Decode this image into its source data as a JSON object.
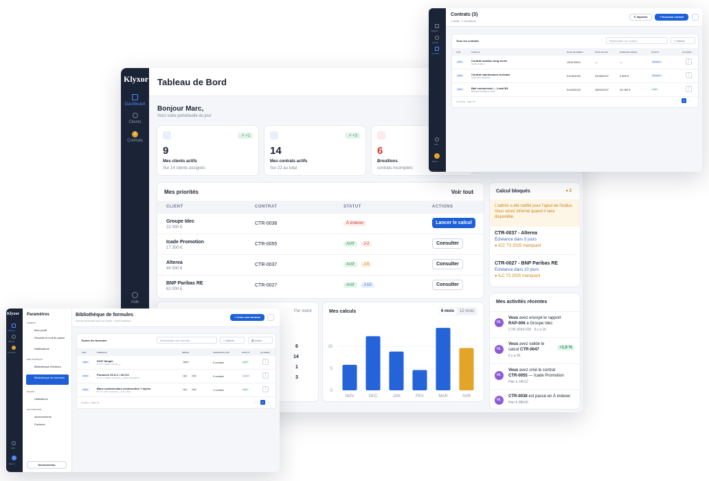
{
  "dashboard": {
    "logo": "Klyxor",
    "title": "Tableau de Bord",
    "nav": [
      {
        "label": "Dashboard"
      },
      {
        "label": "Clients"
      },
      {
        "label": "Contrats",
        "badge": "2"
      },
      {
        "label": "Aide"
      }
    ],
    "greeting": "Bonjour Marc,",
    "subtitle": "Voici votre portefeuille du jour",
    "stats": [
      {
        "value": "9",
        "label": "Mes clients actifs",
        "sub": "Sur 14 clients assignés",
        "delta": "+1",
        "icon": "users-icon"
      },
      {
        "value": "14",
        "label": "Mes contrats actifs",
        "sub": "Sur 22 au total",
        "delta": "+3",
        "icon": "document-icon"
      },
      {
        "value": "6",
        "label": "Brouillons",
        "sub": "contrats incomplets",
        "icon": "pencil-icon"
      }
    ],
    "priorities": {
      "title": "Mes priorités",
      "link": "Voir tout",
      "headers": [
        "CLIENT",
        "CONTRAT",
        "STATUT",
        "ACTIONS"
      ],
      "rows": [
        {
          "client": "Groupe Idec",
          "amount": "22 000 €",
          "contract": "CTR-0038",
          "status": "À indexer",
          "action": "Lancer le calcul"
        },
        {
          "client": "Icade Promotion",
          "amount": "17 300 €",
          "contract": "CTR-0055",
          "status": "Actif",
          "days": "J-2",
          "action": "Consulter"
        },
        {
          "client": "Alterea",
          "amount": "44 500 €",
          "contract": "CTR-0037",
          "status": "Actif",
          "days": "J-5",
          "action": "Consulter"
        },
        {
          "client": "BNP Paribas RE",
          "amount": "62 000 €",
          "contract": "CTR-0027",
          "status": "Actif",
          "days": "J-10",
          "action": "Consulter"
        }
      ]
    },
    "blocked": {
      "title": "Calcul bloqués",
      "count": "2",
      "notice": "L'admin a été notifié pour l'ajout de l'indice. Vous serez informé quand il sera disponible.",
      "items": [
        {
          "title": "CTR-0037 - Alterea",
          "due": "Échéance dans 5 jours",
          "missing": "ICC T3 2025 manquant"
        },
        {
          "title": "CTR-0027 - BNP Paribas RE",
          "due": "Échéance dans 10 jours",
          "missing": "ILC T3 2025 manquant"
        }
      ]
    },
    "by_status_label": "Par statut",
    "by_status_values": [
      "6",
      "14",
      "1",
      "3"
    ],
    "calc": {
      "title": "Mes calculs",
      "tabs": [
        "6 mois",
        "12 mois"
      ]
    },
    "activity": {
      "title": "Mes activités récentes",
      "items": [
        {
          "avatar": "ML",
          "l1a": "Vous",
          "l1b": " avez envoyé le rapport",
          "l2a": "RAP-006",
          "l2b": " à Groupe Idec",
          "meta": "CTR-2024-018 · Il y a 1h"
        },
        {
          "avatar": "ML",
          "l1a": "Vous",
          "l1b": " avez validé le",
          "l2a": "",
          "l2b": "calcul ",
          "l2c": "CTR-0047",
          "meta": "Il y a 3h",
          "delta": "+2,8 %"
        },
        {
          "avatar": "ML",
          "l1a": "Vous",
          "l1b": " avez créé le contrat",
          "l2a": "CTR-0055",
          "l2b": " — Icade Promotion",
          "meta": "Hier à 14h12"
        },
        {
          "avatar": "ML",
          "l1a": "CTR-0038",
          "l1b": " est passé en À indexer",
          "l2a": "",
          "l2b": "",
          "meta": "Hier à 08h00"
        }
      ]
    }
  },
  "chart_data": {
    "type": "bar",
    "title": "Mes calculs",
    "categories": [
      "NOV",
      "DEC",
      "JAN",
      "FEV",
      "MAR",
      "AVR"
    ],
    "values": [
      5.8,
      12.3,
      8.8,
      4.6,
      14.2,
      9.6
    ],
    "ylim": [
      0,
      15
    ],
    "yticks": [
      "0",
      "5",
      "10"
    ],
    "colors": [
      "#2563d9",
      "#2563d9",
      "#2563d9",
      "#2563d9",
      "#2563d9",
      "#e2a528"
    ]
  },
  "contracts": {
    "title": "Contrats (3)",
    "subtitle": "1 actifs · 2 brouillons",
    "import": "Importer",
    "new": "+ Nouveau contrat",
    "card_title": "Tous les contrats",
    "search": "Rechercher un contrat...",
    "filter": "Statuts",
    "headers": [
      "CTR",
      "LIBELLÉ",
      "DATE DE DÉBUT",
      "DATE DE FIN",
      "MONTANT INITIAL",
      "STATUT",
      "ACTIONS"
    ],
    "rows": [
      {
        "ctr": "0001",
        "name": "Contrat location long terme",
        "sub": "Sophie Aubert",
        "start": "15/11/2024",
        "end": "—",
        "amount": "—",
        "status": "Brouillon"
      },
      {
        "ctr": "0002",
        "name": "Contrat maintenance bureaux",
        "sub": "TechnoSol Industries",
        "start": "01/09/2024",
        "end": "31/08/2027",
        "amount": "9 600 €",
        "status": "Brouillon"
      },
      {
        "ctr": "0003",
        "name": "Bail commercial — Local B2",
        "sub": "Boulodrie Parisienne SAS",
        "start": "01/03/2022",
        "end": "28/02/2027",
        "amount": "24 000 €",
        "status": "Actif"
      }
    ],
    "footer": "3 contrats · Page 1/1",
    "nav": [
      "Tableau",
      "Clients",
      "Contrats",
      "Aide",
      "Marc L."
    ]
  },
  "formulas": {
    "logo": "Klyxor",
    "settings_title": "Paramètres",
    "sections": [
      {
        "label": "COMPTE",
        "items": [
          "Mon profil",
          "Sécurité et mot de passe",
          "Notifications"
        ]
      },
      {
        "label": "BIBLIOTHÈQUE",
        "items": [
          "Bibliothèque d'indices",
          "Bibliothèque de formules"
        ]
      },
      {
        "label": "ÉQUIPE",
        "items": [
          "Utilisateurs"
        ]
      },
      {
        "label": "FACTURATION",
        "items": [
          "Abonnements",
          "Factures"
        ]
      }
    ],
    "logout": "Déconnexion",
    "title": "Bibliothèque de formules",
    "subtitle": "Formules d'indexation liées aux contrats · Calculs pratiquées",
    "create": "+ Créer une formule",
    "card_title": "Toutes les formules",
    "search": "Rechercher une formule...",
    "filter1": "Statuts",
    "filter2": "Indice",
    "headers": [
      "FOR",
      "FORMULE",
      "INDICE",
      "CONTRATS LIÉS",
      "STATUT",
      "ACTIONS"
    ],
    "rows": [
      {
        "code": "0001",
        "name": "ICHT Simple",
        "formula": "P = P × (ICHTₙ / ICHTₙ₋₁)",
        "idx": [
          "ICHT"
        ],
        "count": "0 contrat",
        "status": "Actif"
      },
      {
        "code": "0002",
        "name": "Pondérée 60 ILC / 40 ICC",
        "formula": "P = P₀ × (0,60 × ILCₙ/ILC₀ + 0,40 × ICCₙ/ICC₀)",
        "idx": [
          "ILC",
          "ICC"
        ],
        "count": "0 contrat",
        "status": "Inactif"
      },
      {
        "code": "0003",
        "name": "Baux commerciaux construction + loyers",
        "formula": "P = P × (0,5 × ILCₙ/ILC₀ + 0,5 × ICC)",
        "idx": [
          "ILC",
          "ICC"
        ],
        "count": "1 contrat",
        "status": "Actif"
      }
    ],
    "footer": "3 indices · Page 1/1",
    "nav": [
      "Tableau",
      "Clients",
      "Contrats",
      "Aide",
      "Marc L."
    ]
  }
}
